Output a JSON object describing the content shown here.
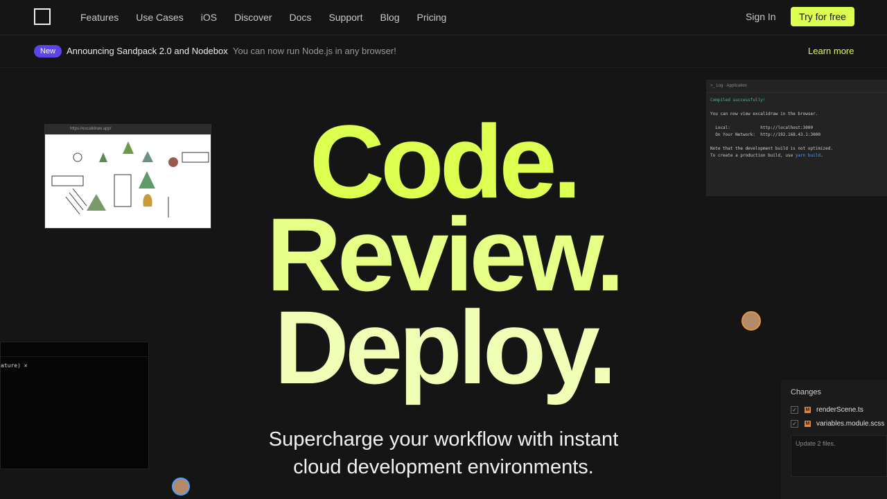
{
  "nav": {
    "links": [
      "Features",
      "Use Cases",
      "iOS",
      "Discover",
      "Docs",
      "Support",
      "Blog",
      "Pricing"
    ],
    "signin": "Sign In",
    "cta": "Try for free"
  },
  "announcement": {
    "badge": "New",
    "title": "Announcing Sandpack 2.0 and Nodebox",
    "subtitle": "You can now run Node.js in any browser!",
    "link": "Learn more"
  },
  "hero": {
    "line1": "Code.",
    "line2": "Review.",
    "line3": "Deploy.",
    "subtitle_line1": "Supercharge your workflow with instant",
    "subtitle_line2": "cloud development environments."
  },
  "preview": {
    "sketch_url": "https://excalidraw.app/",
    "console_title": ">_ Log · Application",
    "console_line1": "Compiled successfully!",
    "console_line2": "You can now view excalidraw in the browser.",
    "console_local": "  Local:            http://localhost:3000",
    "console_network": "  On Your Network:  http://192.168.43.1:3000",
    "console_note1": "Note that the development build is not optimized.",
    "console_note2_pre": "To create a production build, use ",
    "console_note2_cmd": "yarn build",
    "console_note2_post": ".",
    "terminal_text": "ature) ×"
  },
  "changes": {
    "title": "Changes",
    "files": [
      "renderScene.ts",
      "variables.module.scss"
    ],
    "message_placeholder": "Update 2 files."
  }
}
